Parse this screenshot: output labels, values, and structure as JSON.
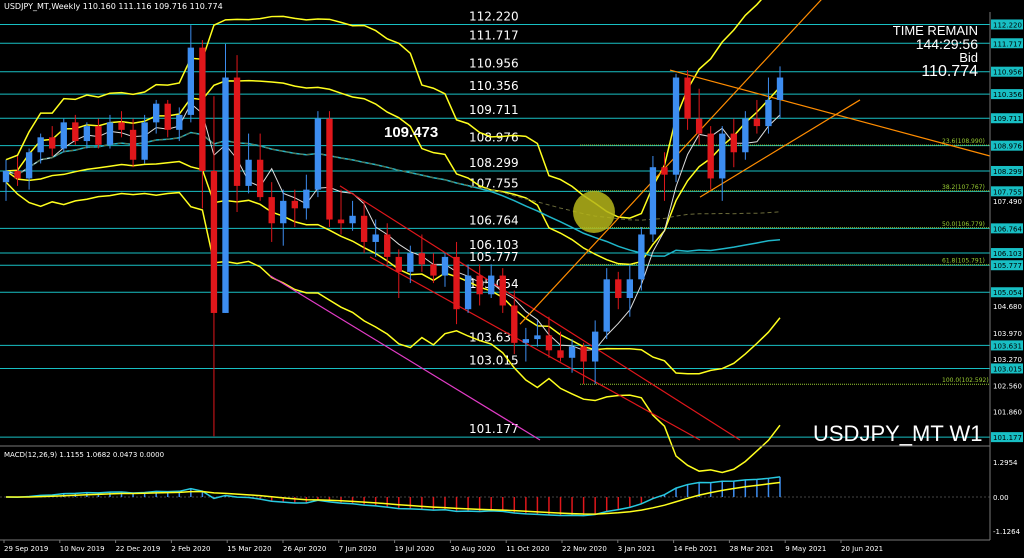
{
  "header": {
    "title": "USDJPY_MT,Weekly  110.160 111.116 109.716 110.774"
  },
  "timer": {
    "label": "TIME REMAIN",
    "value": "144:29:56",
    "bid_label": "Bid",
    "bid_value": "110.774"
  },
  "symbol": {
    "label": "USDJPY_MT W1"
  },
  "highlight": {
    "label": "109.473"
  },
  "levels": [
    {
      "value": "112.220",
      "label": "112.220"
    },
    {
      "value": "111.717",
      "label": "111.717"
    },
    {
      "value": "110.956",
      "label": "110.956"
    },
    {
      "value": "110.356",
      "label": "110.356"
    },
    {
      "value": "109.711",
      "label": "109.711"
    },
    {
      "value": "108.976",
      "label": "108.976"
    },
    {
      "value": "108.299",
      "label": "108.299"
    },
    {
      "value": "107.755",
      "label": "107.755"
    },
    {
      "value": "106.764",
      "label": "106.764"
    },
    {
      "value": "106.103",
      "label": "106.103"
    },
    {
      "value": "105.777",
      "label": "105.777"
    },
    {
      "value": "105.054",
      "label": "105.054"
    },
    {
      "value": "103.631",
      "label": "103.631"
    },
    {
      "value": "103.015",
      "label": "103.015"
    },
    {
      "value": "101.177",
      "label": "101.177"
    }
  ],
  "axis_labels": [
    {
      "value": 107.49,
      "label": "107.490"
    },
    {
      "value": 104.68,
      "label": "104.680"
    },
    {
      "value": 103.97,
      "label": "103.970"
    },
    {
      "value": 103.27,
      "label": "103.270"
    },
    {
      "value": 102.56,
      "label": "102.560"
    },
    {
      "value": 101.86,
      "label": "101.860"
    }
  ],
  "fibo": [
    {
      "label": "23.6(108.990)",
      "value": 108.99
    },
    {
      "label": "38.2(107.767)",
      "value": 107.767
    },
    {
      "label": "50.0(106.779)",
      "value": 106.779
    },
    {
      "label": "61.8(105.791)",
      "value": 105.791
    },
    {
      "label": "100.0(102.592)",
      "value": 102.592
    }
  ],
  "macd": {
    "label": "MACD(12,26,9) 1.1155 1.0682 0.0473 0.0000",
    "top": "1.2954",
    "zero": "0.00",
    "bottom": "-1.1264"
  },
  "dates": [
    "29 Sep 2019",
    "10 Nov 2019",
    "22 Dec 2019",
    "2 Feb 2020",
    "15 Mar 2020",
    "26 Apr 2020",
    "7 Jun 2020",
    "19 Jul 2020",
    "30 Aug 2020",
    "11 Oct 2020",
    "22 Nov 2020",
    "3 Jan 2021",
    "14 Feb 2021",
    "28 Mar 2021",
    "9 May 2021",
    "20 Jun 2021"
  ],
  "colors": {
    "bull": "#3d8df0",
    "bear": "#e0171b",
    "band": "#ffff1e",
    "level": "#18bfc4",
    "fibo": "#9acd32",
    "channel": "#ff8c00"
  },
  "chart_data": {
    "type": "candlestick",
    "symbol": "USDJPY_MT",
    "timeframe": "Weekly",
    "candles": [
      [
        108.0,
        108.6,
        107.5,
        108.3
      ],
      [
        108.3,
        108.7,
        107.9,
        108.1
      ],
      [
        108.1,
        108.9,
        107.8,
        108.8
      ],
      [
        108.8,
        109.3,
        108.5,
        109.2
      ],
      [
        109.2,
        109.5,
        108.7,
        108.9
      ],
      [
        108.9,
        109.7,
        108.8,
        109.6
      ],
      [
        109.6,
        109.8,
        109.0,
        109.1
      ],
      [
        109.1,
        109.6,
        108.9,
        109.5
      ],
      [
        109.5,
        109.7,
        108.9,
        109.0
      ],
      [
        109.0,
        109.8,
        108.9,
        109.6
      ],
      [
        109.6,
        109.9,
        109.2,
        109.4
      ],
      [
        109.4,
        109.7,
        108.4,
        108.6
      ],
      [
        108.6,
        109.8,
        108.5,
        109.6
      ],
      [
        109.6,
        110.2,
        109.3,
        110.1
      ],
      [
        110.1,
        110.2,
        109.2,
        109.4
      ],
      [
        109.4,
        110.0,
        109.1,
        109.8
      ],
      [
        109.8,
        112.2,
        109.6,
        111.6
      ],
      [
        111.6,
        111.8,
        107.3,
        108.3
      ],
      [
        108.3,
        110.3,
        101.2,
        104.5
      ],
      [
        104.5,
        111.7,
        104.5,
        110.8
      ],
      [
        110.8,
        111.4,
        107.2,
        107.9
      ],
      [
        107.9,
        109.3,
        107.7,
        108.6
      ],
      [
        108.6,
        109.3,
        107.5,
        107.6
      ],
      [
        107.6,
        108.0,
        106.4,
        106.9
      ],
      [
        106.9,
        107.8,
        106.3,
        107.5
      ],
      [
        107.5,
        107.8,
        106.8,
        107.3
      ],
      [
        107.3,
        108.2,
        107.0,
        107.8
      ],
      [
        107.8,
        109.9,
        107.6,
        109.7
      ],
      [
        109.7,
        109.9,
        106.8,
        107.0
      ],
      [
        107.0,
        107.8,
        106.6,
        106.9
      ],
      [
        106.9,
        107.5,
        106.7,
        107.1
      ],
      [
        107.1,
        107.5,
        106.1,
        106.4
      ],
      [
        106.4,
        107.0,
        106.0,
        106.6
      ],
      [
        106.6,
        106.9,
        105.8,
        106.0
      ],
      [
        106.0,
        106.2,
        104.9,
        105.6
      ],
      [
        105.6,
        106.3,
        105.3,
        106.1
      ],
      [
        106.1,
        106.6,
        105.6,
        105.8
      ],
      [
        105.8,
        106.1,
        105.3,
        105.5
      ],
      [
        105.5,
        106.1,
        105.2,
        106.0
      ],
      [
        106.0,
        106.4,
        104.2,
        104.6
      ],
      [
        104.6,
        105.8,
        104.5,
        105.5
      ],
      [
        105.5,
        105.8,
        104.7,
        105.0
      ],
      [
        105.0,
        105.8,
        104.9,
        105.5
      ],
      [
        105.5,
        105.7,
        104.5,
        104.7
      ],
      [
        104.7,
        105.1,
        103.4,
        103.7
      ],
      [
        103.7,
        104.1,
        103.2,
        103.8
      ],
      [
        103.8,
        104.3,
        103.6,
        103.9
      ],
      [
        103.9,
        104.4,
        103.3,
        103.5
      ],
      [
        103.5,
        104.0,
        103.2,
        103.3
      ],
      [
        103.3,
        103.8,
        102.9,
        103.6
      ],
      [
        103.6,
        103.7,
        102.6,
        103.2
      ],
      [
        103.2,
        104.3,
        102.6,
        104.0
      ],
      [
        104.0,
        105.7,
        103.8,
        105.4
      ],
      [
        105.4,
        105.6,
        104.6,
        104.9
      ],
      [
        104.9,
        105.8,
        104.4,
        105.4
      ],
      [
        105.4,
        106.8,
        105.1,
        106.6
      ],
      [
        106.6,
        108.7,
        106.4,
        108.4
      ],
      [
        108.4,
        108.8,
        107.5,
        108.2
      ],
      [
        108.2,
        110.9,
        108.0,
        110.8
      ],
      [
        110.8,
        111.0,
        109.4,
        109.7
      ],
      [
        109.7,
        110.5,
        109.0,
        109.3
      ],
      [
        109.3,
        109.5,
        107.8,
        108.1
      ],
      [
        108.1,
        109.5,
        107.5,
        109.3
      ],
      [
        109.3,
        109.7,
        108.4,
        108.8
      ],
      [
        108.8,
        109.9,
        108.6,
        109.7
      ],
      [
        109.7,
        110.2,
        109.3,
        109.5
      ],
      [
        109.5,
        110.8,
        109.3,
        110.2
      ],
      [
        110.2,
        111.1,
        109.7,
        110.8
      ]
    ]
  }
}
